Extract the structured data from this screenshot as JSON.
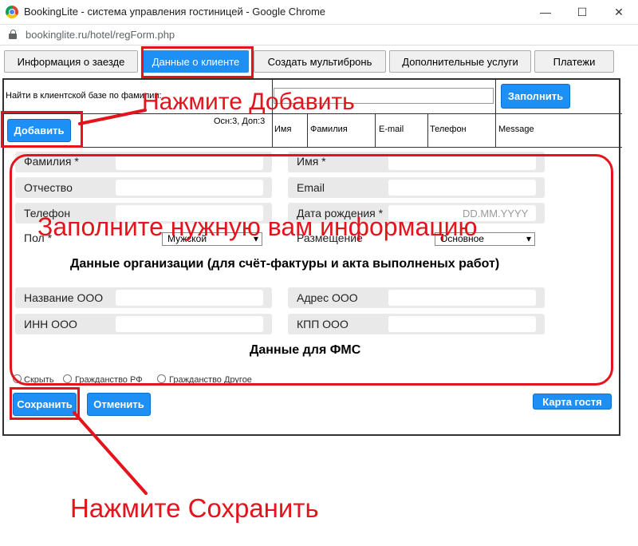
{
  "window": {
    "title": "BookingLite - система управления гостиницей - Google Chrome",
    "url": "bookinglite.ru/hotel/regForm.php",
    "controls": {
      "minimize": "—",
      "maximize": "☐",
      "close": "✕"
    }
  },
  "tabs": [
    {
      "label": "Информация о заезде",
      "active": false
    },
    {
      "label": "Данные о клиенте",
      "active": true
    },
    {
      "label": "Создать мультибронь",
      "active": false
    },
    {
      "label": "Дополнительные услуги",
      "active": false
    },
    {
      "label": "Платежи",
      "active": false
    }
  ],
  "search": {
    "label": "Найти в клиентской базе по фамилии:",
    "fill_button": "Заполнить",
    "add_button": "Добавить",
    "counts": "Осн:3, Доп:3",
    "columns": [
      "Имя",
      "Фамилия",
      "E-mail",
      "Телефон",
      "Message"
    ]
  },
  "form": {
    "surname": "Фамилия *",
    "name": "Имя *",
    "patronymic": "Отчество",
    "email": "Email",
    "phone": "Телефон",
    "birthdate": "Дата рождения *",
    "birthdate_placeholder": "DD.MM.YYYY",
    "gender": "Пол *",
    "gender_value": "Мужской",
    "placement": "Размещение",
    "placement_value": "Основное"
  },
  "org": {
    "title": "Данные организации (для счёт-фактуры и акта выполненых работ)",
    "name": "Название ООО",
    "address": "Адрес ООО",
    "inn": "ИНН ООО",
    "kpp": "КПП ООО"
  },
  "fms": {
    "title": "Данные для ФМС",
    "options": [
      "Скрыть",
      "Гражданство РФ",
      "Гражданство Другое"
    ]
  },
  "actions": {
    "save": "Сохранить",
    "cancel": "Отменить",
    "guest_card": "Карта гостя"
  },
  "annotations": {
    "add_hint": "Нажмите Добавить",
    "fill_hint": "Заполните нужную вам информацию",
    "save_hint": "Нажмите Сохранить",
    "color": "#e3141c"
  }
}
